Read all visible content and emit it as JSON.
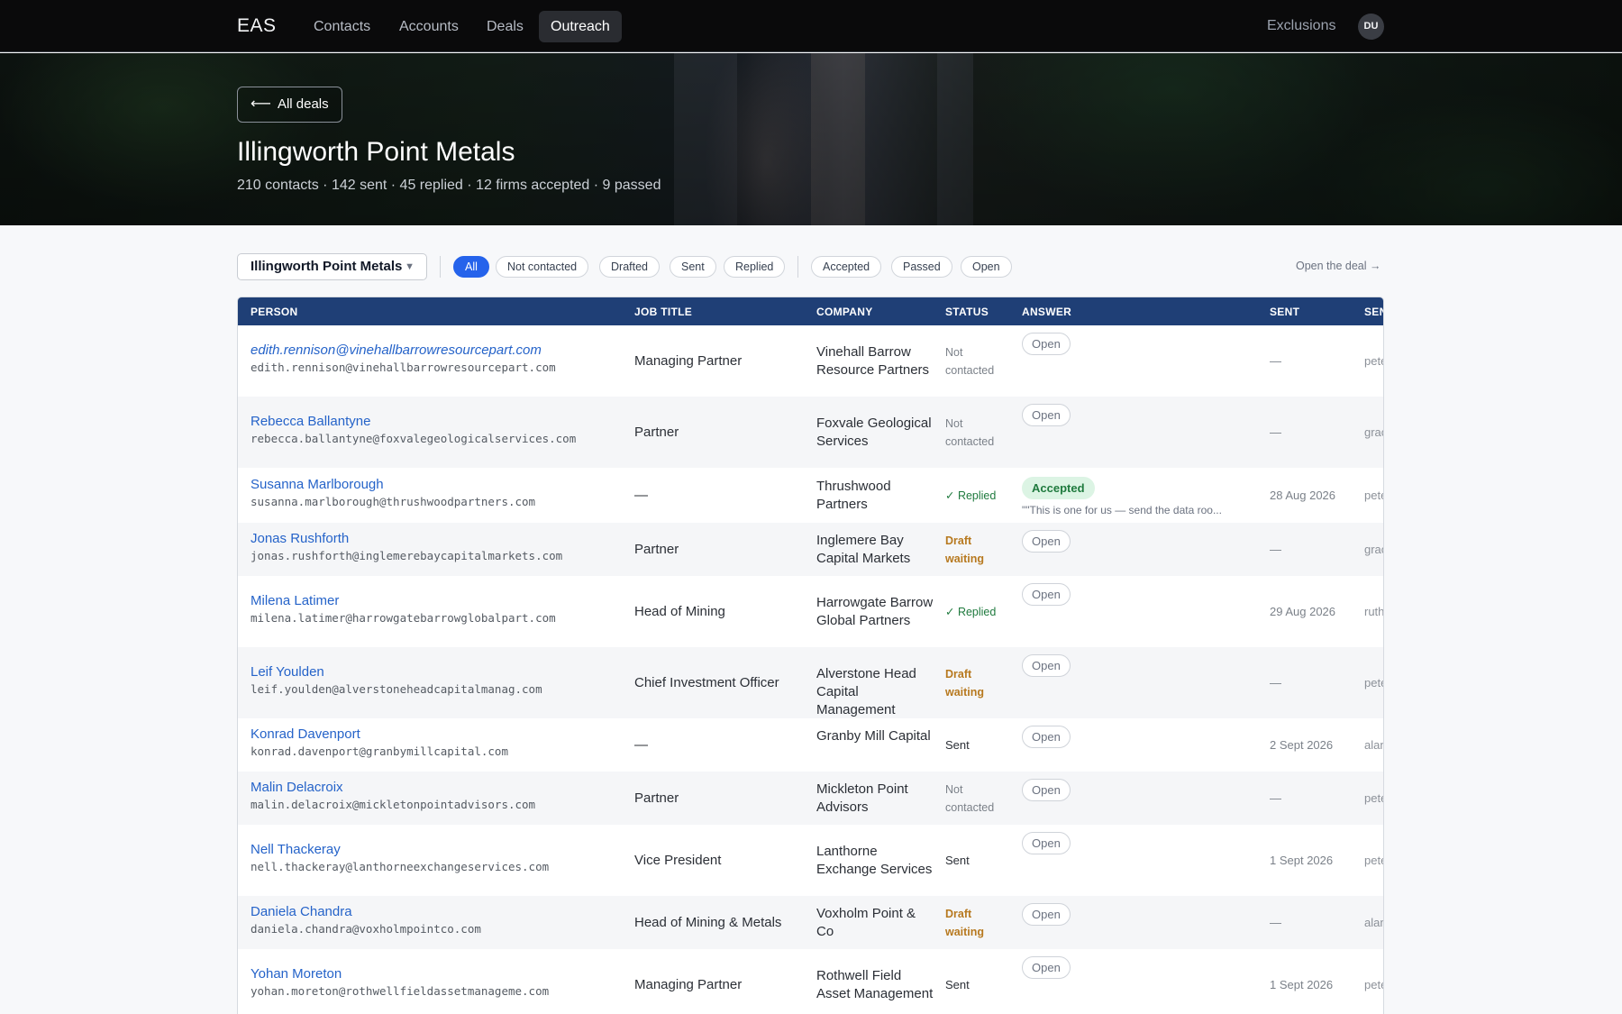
{
  "nav": {
    "brand": "EAS",
    "items": [
      "Contacts",
      "Accounts",
      "Deals",
      "Outreach"
    ],
    "active": "Outreach",
    "exclusions": "Exclusions",
    "avatar": "DU"
  },
  "hero": {
    "back_label": "All deals",
    "back_icon": "left-arrow-icon",
    "title": "Illingworth Point Metals",
    "stats": "210 contacts · 142 sent · 45 replied · 12 firms accepted · 9 passed"
  },
  "filters": {
    "deal_select": "Illingworth Point Metals",
    "group1": [
      "All",
      "Not contacted",
      "Drafted",
      "Sent",
      "Replied"
    ],
    "group2": [
      "Accepted",
      "Passed",
      "Open"
    ],
    "active": "All",
    "open_deal": "Open the deal →"
  },
  "table": {
    "columns": [
      "PERSON",
      "JOB TITLE",
      "COMPANY",
      "STATUS",
      "ANSWER",
      "SENT",
      "SEN"
    ],
    "rows": [
      {
        "name": "edith.rennison@vinehallbarrowresourcepart.com",
        "email": "edith.rennison@vinehallbarrowresourcepart.com",
        "job": "Managing Partner",
        "company": "Vinehall Barrow Resource Partners",
        "status": "Not contacted",
        "status_kind": "not",
        "answer": "Open",
        "answer_kind": "open",
        "quote": "",
        "sent": "—",
        "sender": "pete"
      },
      {
        "name": "Rebecca Ballantyne",
        "email": "rebecca.ballantyne@foxvalegeologicalservices.com",
        "job": "Partner",
        "company": "Foxvale Geological Services",
        "status": "Not contacted",
        "status_kind": "not",
        "answer": "Open",
        "answer_kind": "open",
        "quote": "",
        "sent": "—",
        "sender": "grac"
      },
      {
        "name": "Susanna Marlborough",
        "email": "susanna.marlborough@thrushwoodpartners.com",
        "job": "—",
        "company": "Thrushwood Partners",
        "status": "✓ Replied",
        "status_kind": "replied",
        "answer": "Accepted",
        "answer_kind": "accepted",
        "quote": "\"\"This is one for us — send the data roo...",
        "sent": "28 Aug 2026",
        "sender": "pete"
      },
      {
        "name": "Jonas Rushforth",
        "email": "jonas.rushforth@inglemerebaycapitalmarkets.com",
        "job": "Partner",
        "company": "Inglemere Bay Capital Markets",
        "status": "Draft waiting",
        "status_kind": "draft",
        "answer": "Open",
        "answer_kind": "open",
        "quote": "",
        "sent": "—",
        "sender": "grac"
      },
      {
        "name": "Milena Latimer",
        "email": "milena.latimer@harrowgatebarrowglobalpart.com",
        "job": "Head of Mining",
        "company": "Harrowgate Barrow Global Partners",
        "status": "✓ Replied",
        "status_kind": "replied",
        "answer": "Open",
        "answer_kind": "open",
        "quote": "",
        "sent": "29 Aug 2026",
        "sender": "ruth"
      },
      {
        "name": "Leif Youlden",
        "email": "leif.youlden@alverstoneheadcapitalmanag.com",
        "job": "Chief Investment Officer",
        "company": "Alverstone Head Capital Management",
        "status": "Draft waiting",
        "status_kind": "draft",
        "answer": "Open",
        "answer_kind": "open",
        "quote": "",
        "sent": "—",
        "sender": "pete"
      },
      {
        "name": "Konrad Davenport",
        "email": "konrad.davenport@granbymillcapital.com",
        "job": "—",
        "company": "Granby Mill Capital",
        "status": "Sent",
        "status_kind": "sent",
        "answer": "Open",
        "answer_kind": "open",
        "quote": "",
        "sent": "2 Sept 2026",
        "sender": "alan"
      },
      {
        "name": "Malin Delacroix",
        "email": "malin.delacroix@mickletonpointadvisors.com",
        "job": "Partner",
        "company": "Mickleton Point Advisors",
        "status": "Not contacted",
        "status_kind": "not",
        "answer": "Open",
        "answer_kind": "open",
        "quote": "",
        "sent": "—",
        "sender": "pete"
      },
      {
        "name": "Nell Thackeray",
        "email": "nell.thackeray@lanthorneexchangeservices.com",
        "job": "Vice President",
        "company": "Lanthorne Exchange Services",
        "status": "Sent",
        "status_kind": "sent",
        "answer": "Open",
        "answer_kind": "open",
        "quote": "",
        "sent": "1 Sept 2026",
        "sender": "pete"
      },
      {
        "name": "Daniela Chandra",
        "email": "daniela.chandra@voxholmpointco.com",
        "job": "Head of Mining & Metals",
        "company": "Voxholm Point & Co",
        "status": "Draft waiting",
        "status_kind": "draft",
        "answer": "Open",
        "answer_kind": "open",
        "quote": "",
        "sent": "—",
        "sender": "alan"
      },
      {
        "name": "Yohan Moreton",
        "email": "yohan.moreton@rothwellfieldassetmanageme.com",
        "job": "Managing Partner",
        "company": "Rothwell Field Asset Management",
        "status": "Sent",
        "status_kind": "sent",
        "answer": "Open",
        "answer_kind": "open",
        "quote": "",
        "sent": "1 Sept 2026",
        "sender": "pete"
      }
    ]
  }
}
